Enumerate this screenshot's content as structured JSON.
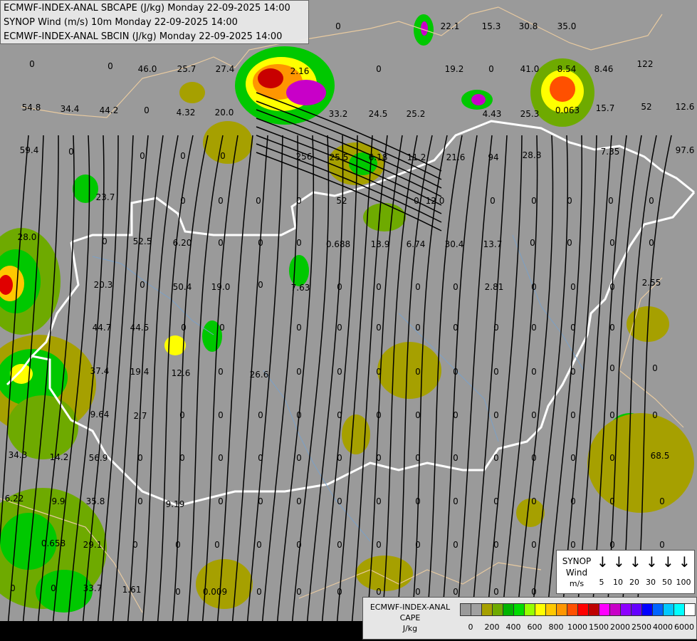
{
  "header": {
    "line1": "ECMWF-INDEX-ANAL SBCAPE (J/kg) Monday 22-09-2025 14:00",
    "line2": "SYNOP Wind (m/s) 10m Monday 22-09-2025 14:00",
    "line3": "ECMWF-INDEX-ANAL SBCIN (J/kg) Monday 22-09-2025 14:00"
  },
  "map_values": [
    "22.1",
    "15.3",
    "30.8",
    "35.0",
    "46.0",
    "25.7",
    "27.4",
    "2.16",
    "19.2",
    "41.0",
    "8.54",
    "8.46",
    "122",
    "54.8",
    "34.4",
    "44.2",
    "4.32",
    "20.0",
    "33.2",
    "24.5",
    "25.2",
    "4.43",
    "25.3",
    "0.063",
    "15.7",
    "52",
    "12.6",
    "59.4",
    "256",
    "25.5",
    "6.18",
    "11.2",
    "21.6",
    "94",
    "28.8",
    "7.35",
    "97.6",
    "23.7",
    "52",
    "12.0",
    "52.5",
    "6.20",
    "0.688",
    "13.9",
    "6.74",
    "30.4",
    "13.7",
    "28.0",
    "20.3",
    "50.4",
    "19.0",
    "7.63",
    "2.81",
    "2.55",
    "44.7",
    "44.5",
    "26.6",
    "37.4",
    "19.4",
    "12.6",
    "9.64",
    "2.7",
    "56.9",
    "14.2",
    "34.3",
    "35.8",
    "9.19",
    "6.22",
    "9.9",
    "0.658",
    "29.1",
    "33.7",
    "1.61",
    "0.009",
    "68.5",
    "0",
    "100",
    "200"
  ],
  "legend_wind": {
    "title_lines": [
      "SYNOP",
      "Wind",
      "m/s"
    ],
    "speeds": [
      "5",
      "10",
      "20",
      "30",
      "50",
      "100"
    ],
    "arrow_icon": "down-arrow-icon"
  },
  "legend_cape": {
    "title_lines": [
      "ECMWF-INDEX-ANAL",
      "CAPE",
      "J/kg"
    ],
    "colors": [
      "#9a9a9a",
      "#a0a0a0",
      "#a6a000",
      "#6eaa00",
      "#00b400",
      "#00dc00",
      "#96ff00",
      "#ffff00",
      "#ffc800",
      "#ff9600",
      "#ff5000",
      "#ff0000",
      "#be0000",
      "#ff00ff",
      "#c800c8",
      "#8c00ff",
      "#6400ff",
      "#0000ff",
      "#0064ff",
      "#00c8ff",
      "#00ffff",
      "#ffffff"
    ],
    "ticks": [
      "0",
      "200",
      "400",
      "600",
      "800",
      "1000",
      "1500",
      "2000",
      "2500",
      "4000",
      "6000"
    ]
  }
}
